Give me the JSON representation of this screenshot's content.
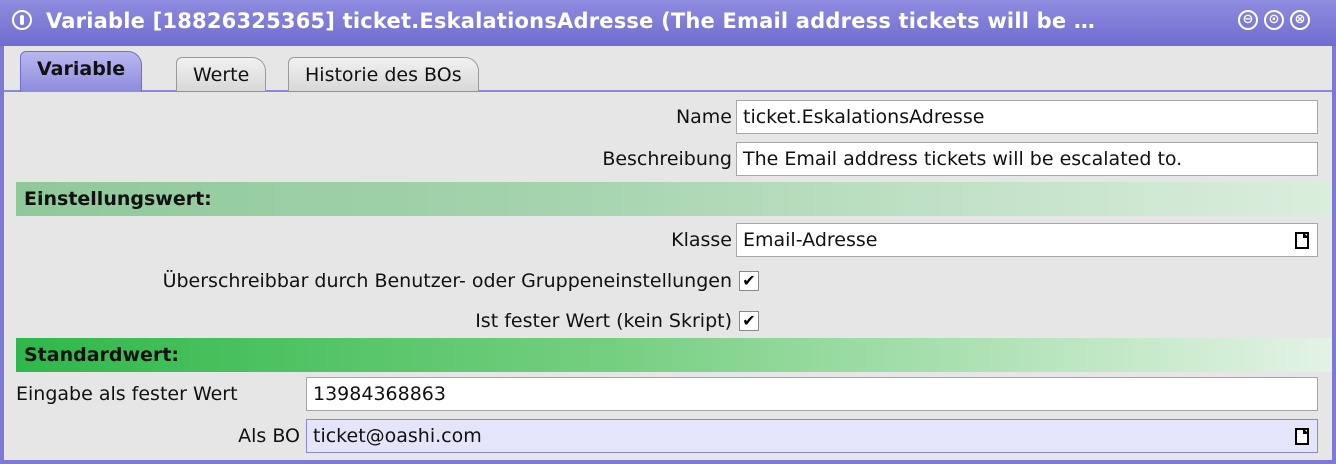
{
  "window": {
    "title": "Variable [18826325365] ticket.EskalationsAdresse (The Email address tickets will be …",
    "controls": {
      "minimize": "⊖",
      "maximize": "⊙",
      "close": "⊗"
    }
  },
  "tabs": [
    {
      "label": "Variable",
      "active": true
    },
    {
      "label": "Werte",
      "active": false
    },
    {
      "label": "Historie des BOs",
      "active": false
    }
  ],
  "form": {
    "name": {
      "label": "Name",
      "value": "ticket.EskalationsAdresse"
    },
    "beschreibung": {
      "label": "Beschreibung",
      "value": "The Email address tickets will be escalated to."
    }
  },
  "einstellungswert": {
    "heading": "Einstellungswert:",
    "klasse": {
      "label": "Klasse",
      "value": "Email-Adresse"
    },
    "ueberschreibbar": {
      "label": "Überschreibbar durch Benutzer- oder Gruppeneinstellungen",
      "checked": "✔"
    },
    "fester_wert": {
      "label": "Ist fester Wert (kein Skript)",
      "checked": "✔"
    }
  },
  "standardwert": {
    "heading": "Standardwert:",
    "eingabe": {
      "label": "Eingabe als fester Wert",
      "value": "13984368863"
    },
    "als_bo": {
      "label": "Als BO",
      "value": "ticket@oashi.com"
    }
  },
  "colors": {
    "accent": "#7c7ad6",
    "section_green": "#2fb84a",
    "section_green_light": "#8fc99a"
  }
}
